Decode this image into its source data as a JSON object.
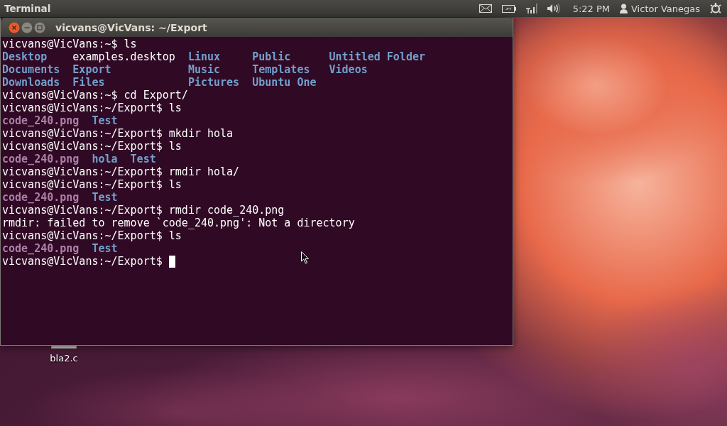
{
  "panel": {
    "app_title": "Terminal",
    "indicators": [
      {
        "kind": "mail"
      },
      {
        "kind": "battery"
      },
      {
        "kind": "signal"
      },
      {
        "kind": "volume"
      }
    ],
    "clock": "5:22 PM",
    "user": "Victor Vanegas",
    "session": {
      "kind": "power"
    }
  },
  "desktop": {
    "icons": [
      {
        "label": "bla2.c",
        "kind": "file"
      }
    ]
  },
  "terminal": {
    "title": "vicvans@VicVans: ~/Export",
    "lines": [
      {
        "kind": "prompt",
        "text": "vicvans@VicVans:~$ ls"
      },
      {
        "kind": "listing",
        "columns": [
          [
            {
              "name": "Desktop",
              "kind": "dir"
            },
            {
              "name": "Documents",
              "kind": "dir"
            },
            {
              "name": "Downloads",
              "kind": "dir"
            }
          ],
          [
            {
              "name": "examples.desktop",
              "kind": "file"
            },
            {
              "name": "Export",
              "kind": "dir"
            },
            {
              "name": "Files",
              "kind": "dir"
            }
          ],
          [
            {
              "name": "Linux",
              "kind": "dir"
            },
            {
              "name": "Music",
              "kind": "dir"
            },
            {
              "name": "Pictures",
              "kind": "dir"
            }
          ],
          [
            {
              "name": "Public",
              "kind": "dir"
            },
            {
              "name": "Templates",
              "kind": "dir"
            },
            {
              "name": "Ubuntu One",
              "kind": "dir"
            }
          ],
          [
            {
              "name": "Untitled Folder",
              "kind": "dir"
            },
            {
              "name": "Videos",
              "kind": "dir"
            }
          ]
        ]
      },
      {
        "kind": "prompt",
        "text": "vicvans@VicVans:~$ cd Export/"
      },
      {
        "kind": "prompt",
        "text": "vicvans@VicVans:~/Export$ ls"
      },
      {
        "kind": "listing",
        "columns": [
          [
            {
              "name": "code_240.png"
            }
          ],
          [
            {
              "name": "Test",
              "kind": "dir"
            }
          ]
        ]
      },
      {
        "kind": "prompt",
        "text": "vicvans@VicVans:~/Export$ mkdir hola"
      },
      {
        "kind": "prompt",
        "text": "vicvans@VicVans:~/Export$ ls"
      },
      {
        "kind": "listing",
        "columns": [
          [
            {
              "name": "code_240.png"
            }
          ],
          [
            {
              "name": "hola",
              "kind": "dir"
            }
          ],
          [
            {
              "name": "Test",
              "kind": "dir"
            }
          ]
        ]
      },
      {
        "kind": "prompt",
        "text": "vicvans@VicVans:~/Export$ rmdir hola/"
      },
      {
        "kind": "prompt",
        "text": "vicvans@VicVans:~/Export$ ls"
      },
      {
        "kind": "listing",
        "columns": [
          [
            {
              "name": "code_240.png"
            }
          ],
          [
            {
              "name": "Test",
              "kind": "dir"
            }
          ]
        ]
      },
      {
        "kind": "prompt",
        "text": "vicvans@VicVans:~/Export$ rmdir code_240.png"
      },
      {
        "kind": "output",
        "text": "rmdir: failed to remove `code_240.png': Not a directory"
      },
      {
        "kind": "prompt",
        "text": "vicvans@VicVans:~/Export$ ls"
      },
      {
        "kind": "listing",
        "columns": [
          [
            {
              "name": "code_240.png"
            }
          ],
          [
            {
              "name": "Test",
              "kind": "dir"
            }
          ]
        ]
      },
      {
        "kind": "prompt",
        "text": "vicvans@VicVans:~/Export$",
        "cursor": true
      }
    ]
  }
}
